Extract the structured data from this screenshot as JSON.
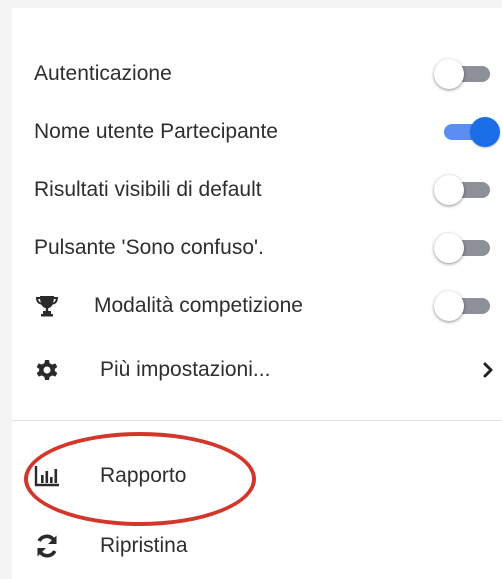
{
  "menu": {
    "toggles": [
      {
        "label": "Autenticazione",
        "on": false
      },
      {
        "label": "Nome utente Partecipante",
        "on": true
      },
      {
        "label": "Risultati visibili di default",
        "on": false
      },
      {
        "label": "Pulsante 'Sono confuso'.",
        "on": false
      },
      {
        "label": "Modalità competizione",
        "on": false,
        "icon": "trophy-icon"
      }
    ],
    "more_settings": {
      "label": "Più impostazioni...",
      "icon": "gear-icon",
      "chevron": "chevron-right-icon"
    },
    "report": {
      "label": "Rapporto",
      "icon": "bar-chart-icon"
    },
    "reset": {
      "label": "Ripristina",
      "icon": "sync-icon"
    }
  },
  "colors": {
    "toggle_on_knob": "#1a6fe8",
    "toggle_on_track": "#5a8ef0",
    "toggle_off_track": "#8d9097",
    "highlight_ellipse": "#d3362b"
  }
}
